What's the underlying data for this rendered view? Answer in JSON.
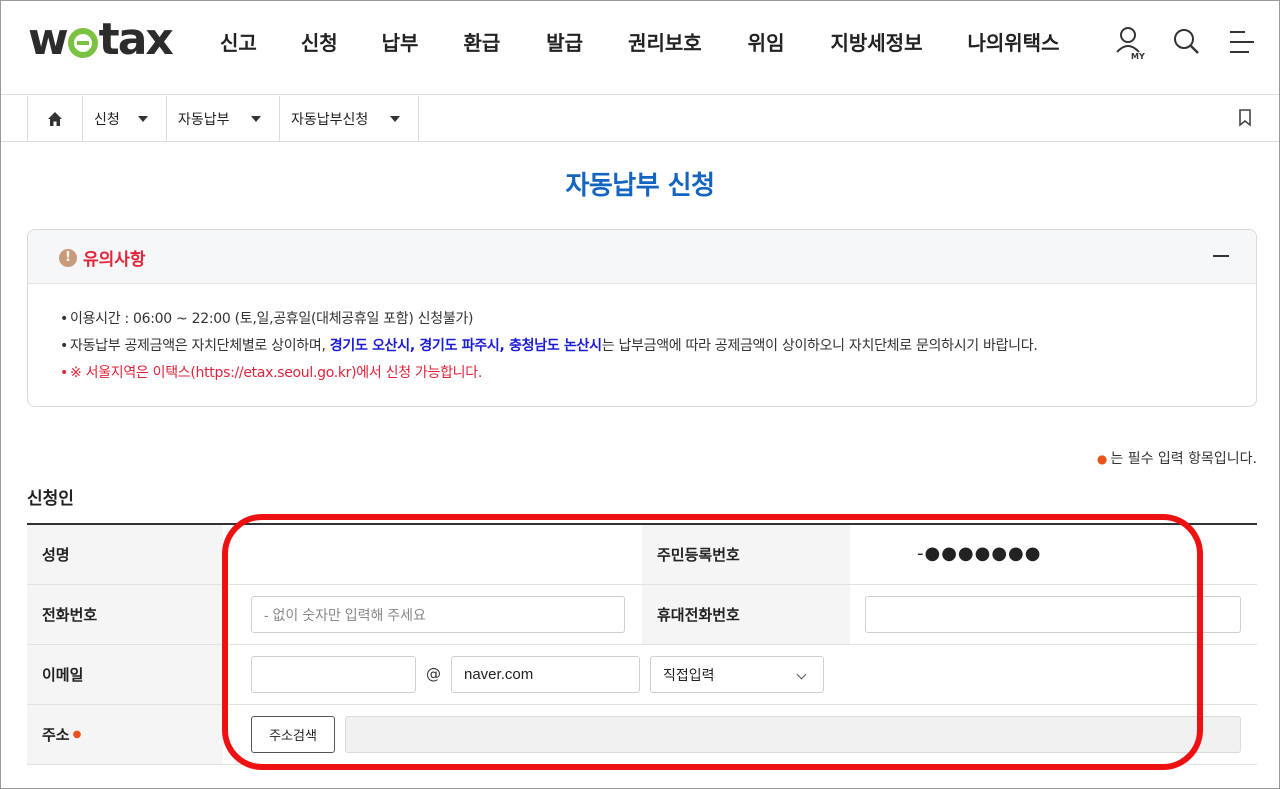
{
  "logo": {
    "text_w": "w",
    "text_rest": "tax",
    "brand_color": "#7cc242"
  },
  "gnb": [
    "신고",
    "신청",
    "납부",
    "환급",
    "발급",
    "권리보호",
    "위임",
    "지방세정보",
    "나의위택스"
  ],
  "header_icons": [
    "my-user-icon",
    "search-icon",
    "menu-icon"
  ],
  "breadcrumb": {
    "items": [
      "신청",
      "자동납부",
      "자동납부신청"
    ]
  },
  "page_title": "자동납부 신청",
  "notice": {
    "title": "유의사항",
    "line1": "이용시간 : 06:00 ~ 22:00 (토,일,공휴일(대체공휴일 포함) 신청불가)",
    "line2_pre": "자동납부 공제금액은 자치단체별로 상이하며, ",
    "line2_hl": "경기도 오산시, 경기도 파주시, 충청남도 논산시",
    "line2_post": "는 납부금액에 따라 공제금액이 상이하오니 자치단체로 문의하시기 바랍니다.",
    "line3": "※ 서울지역은 이택스(https://etax.seoul.go.kr)에서 신청 가능합니다."
  },
  "required_note": "는 필수 입력 항목입니다.",
  "section_title": "신청인",
  "form": {
    "name_label": "성명",
    "rrn_label": "주민등록번호",
    "rrn_masked": "-●●●●●●●",
    "phone_label": "전화번호",
    "phone_placeholder": "- 없이 숫자만 입력해 주세요",
    "mobile_label": "휴대전화번호",
    "email_label": "이메일",
    "email_at": "@",
    "email_domain": "naver.com",
    "email_select": "직접입력",
    "address_label": "주소",
    "address_button": "주소검색"
  },
  "colors": {
    "title_blue": "#1565c0",
    "notice_red": "#e0243a",
    "highlight_red": "#ee1111",
    "required_orange": "#e8541c"
  }
}
